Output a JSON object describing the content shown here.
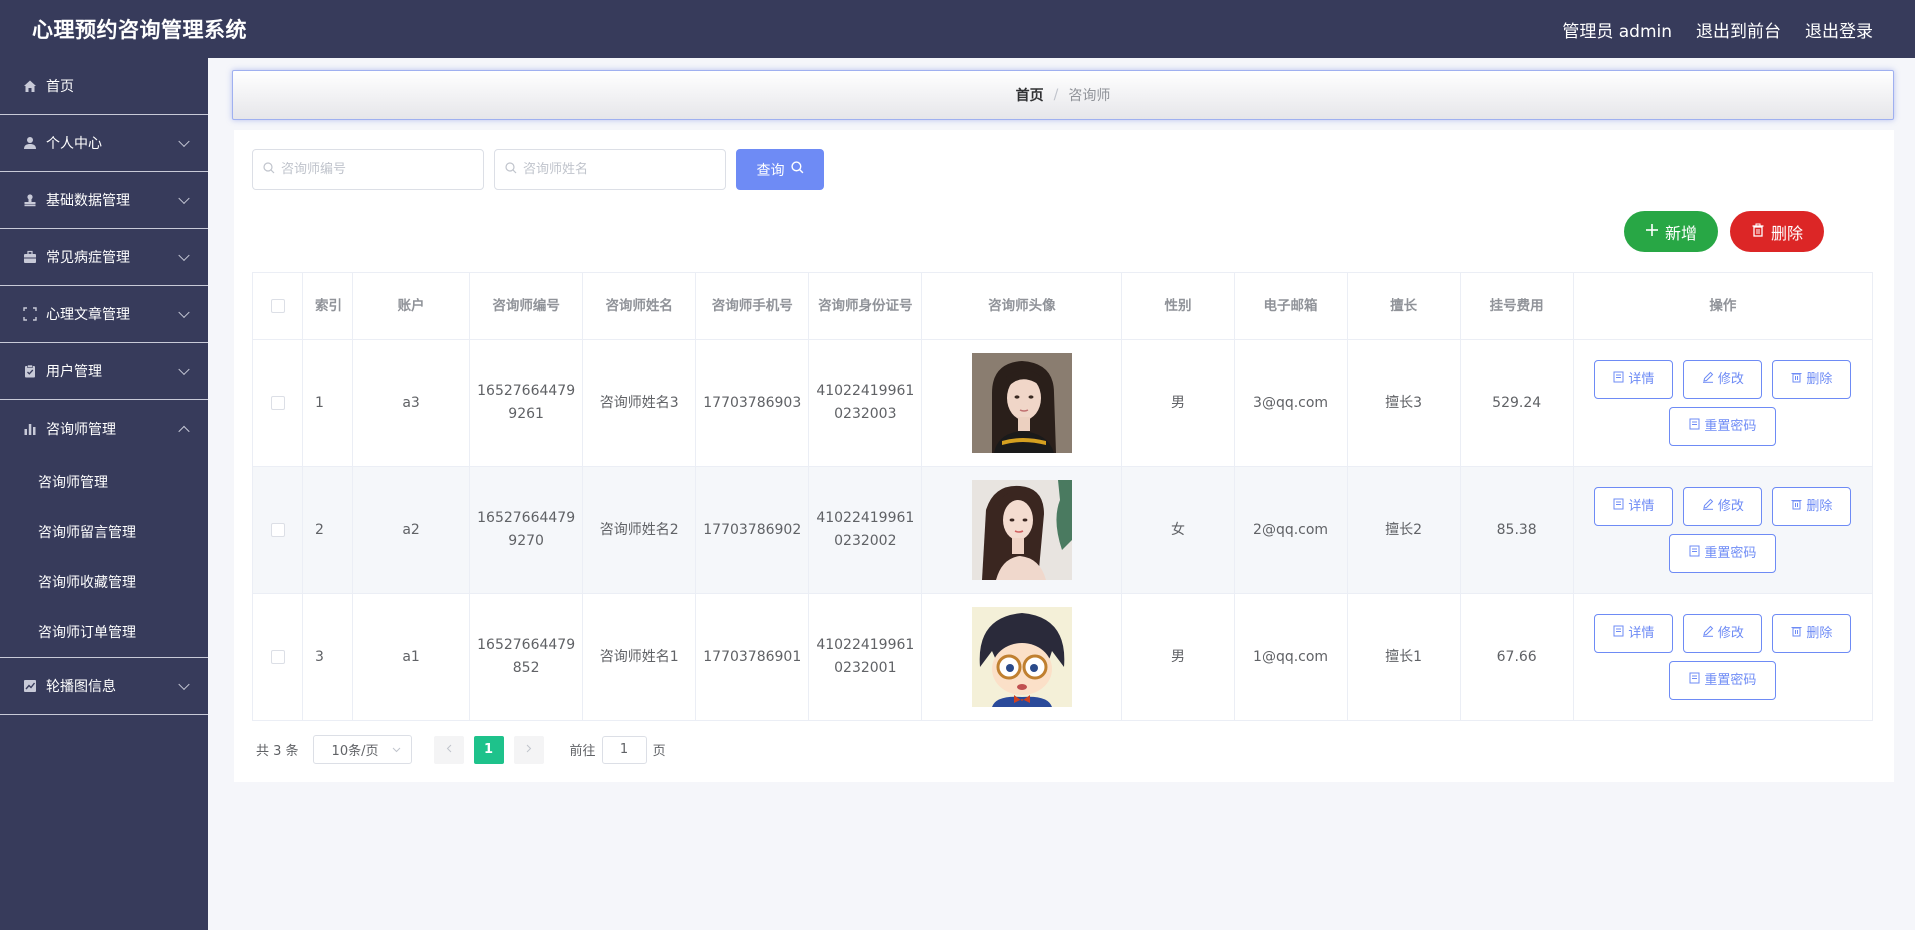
{
  "header": {
    "title": "心理预约咨询管理系统",
    "user_label": "管理员 admin",
    "to_front_label": "退出到前台",
    "logout_label": "退出登录"
  },
  "sidebar": {
    "items": [
      {
        "label": "首页",
        "icon": "home-icon"
      },
      {
        "label": "个人中心",
        "icon": "user-icon"
      },
      {
        "label": "基础数据管理",
        "icon": "user-stamp-icon"
      },
      {
        "label": "常见病症管理",
        "icon": "briefcase-icon"
      },
      {
        "label": "心理文章管理",
        "icon": "frame-icon"
      },
      {
        "label": "用户管理",
        "icon": "clipboard-icon"
      },
      {
        "label": "咨询师管理",
        "icon": "bar-chart-icon"
      },
      {
        "label": "轮播图信息",
        "icon": "chart-check-icon"
      }
    ],
    "sub_items": [
      "咨询师管理",
      "咨询师留言管理",
      "咨询师收藏管理",
      "咨询师订单管理"
    ]
  },
  "breadcrumb": {
    "home": "首页",
    "separator": "/",
    "current": "咨询师"
  },
  "search": {
    "code_placeholder": "咨询师编号",
    "name_placeholder": "咨询师姓名",
    "query_label": "查询"
  },
  "actions": {
    "add_label": "新增",
    "delete_label": "删除"
  },
  "table": {
    "headers": [
      "索引",
      "账户",
      "咨询师编号",
      "咨询师姓名",
      "咨询师手机号",
      "咨询师身份证号",
      "咨询师头像",
      "性别",
      "电子邮箱",
      "擅长",
      "挂号费用",
      "操作"
    ],
    "rows": [
      {
        "index": "1",
        "account": "a3",
        "code": "16527664479 9261",
        "name": "咨询师姓名3",
        "phone": "17703786903",
        "id_card": "41022419961 0232003",
        "gender": "男",
        "email": "3@qq.com",
        "specialty": "擅长3",
        "fee": "529.24"
      },
      {
        "index": "2",
        "account": "a2",
        "code": "16527664479 9270",
        "name": "咨询师姓名2",
        "phone": "17703786902",
        "id_card": "41022419961 0232002",
        "gender": "女",
        "email": "2@qq.com",
        "specialty": "擅长2",
        "fee": "85.38"
      },
      {
        "index": "3",
        "account": "a1",
        "code": "16527664479 852",
        "name": "咨询师姓名1",
        "phone": "17703786901",
        "id_card": "41022419961 0232001",
        "gender": "男",
        "email": "1@qq.com",
        "specialty": "擅长1",
        "fee": "67.66"
      }
    ],
    "row_actions": {
      "detail": "详情",
      "edit": "修改",
      "delete": "删除",
      "reset": "重置密码"
    }
  },
  "pagination": {
    "total": "共 3 条",
    "page_size": "10条/页",
    "current_page": "1",
    "goto_prefix": "前往",
    "goto_value": "1",
    "goto_suffix": "页"
  },
  "colors": {
    "sidebar_bg": "#373b5b",
    "primary": "#6e8bf5",
    "add_green": "#28a745",
    "delete_red": "#dc2626",
    "page_active": "#1ec28b"
  }
}
